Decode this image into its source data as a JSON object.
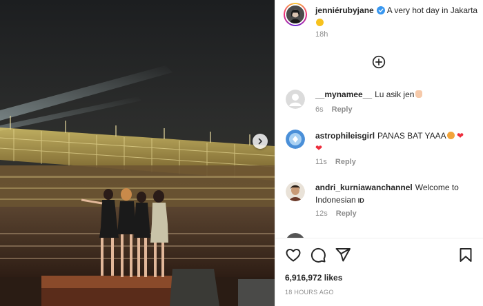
{
  "post": {
    "author": "jenniérubyjane",
    "caption": "A very hot day in Jakarta",
    "caption_emoji": "sun-emoji",
    "age": "18h"
  },
  "comments": [
    {
      "username": "__mynamee__",
      "text": "Lu asik jen",
      "emoji": "hand-emoji",
      "time": "6s",
      "reply": "Reply"
    },
    {
      "username": "astrophileisgirl",
      "text": "PANAS BAT YAAA",
      "emoji": "hot-face-emoji, red-heart-emoji, red-heart-emoji",
      "time": "11s",
      "reply": "Reply"
    },
    {
      "username": "andri_kurniawanchannel",
      "text": "Welcome to Indonesian",
      "flag": "ID",
      "time": "12s",
      "reply": "Reply"
    }
  ],
  "footer": {
    "likes": "6,916,972 likes",
    "timestamp": "18 HOURS AGO"
  },
  "icons": {
    "load_more": "plus-circle-icon",
    "like": "heart-icon",
    "comment": "comment-icon",
    "share": "send-icon",
    "save": "bookmark-icon",
    "next": "chevron-right-icon"
  },
  "colors": {
    "verified": "#3897f0",
    "heart": "#ed2d3c",
    "muted": "#8e8e8e"
  }
}
